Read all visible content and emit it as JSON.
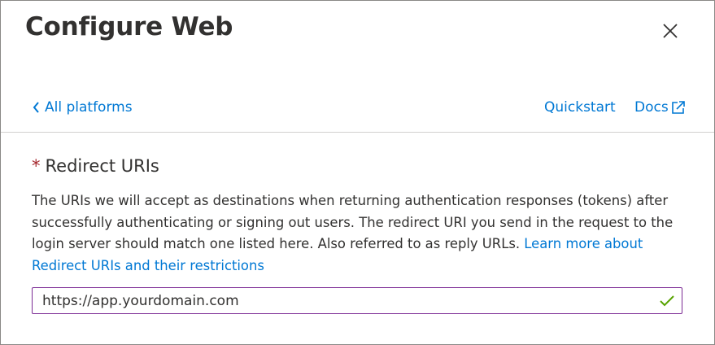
{
  "dialog": {
    "title": "Configure Web"
  },
  "nav": {
    "back_label": "All platforms",
    "quickstart_label": "Quickstart",
    "docs_label": "Docs"
  },
  "redirect": {
    "required_mark": "*",
    "label": "Redirect URIs",
    "description": "The URIs we will accept as destinations when returning authentication responses (tokens) after successfully authenticating or signing out users. The redirect URI you send in the request to the login server should match one listed here. Also referred to as reply URLs.",
    "learn_more": "Learn more about Redirect URIs and their restrictions",
    "uri_value": "https://app.yourdomain.com"
  },
  "colors": {
    "link": "#0078d4",
    "required": "#a4262c",
    "input_border": "#7b2a94",
    "valid_check": "#57a300"
  },
  "icons": {
    "close": "close-icon",
    "back": "chevron-left-icon",
    "docs": "external-link-icon",
    "valid": "checkmark-icon"
  }
}
